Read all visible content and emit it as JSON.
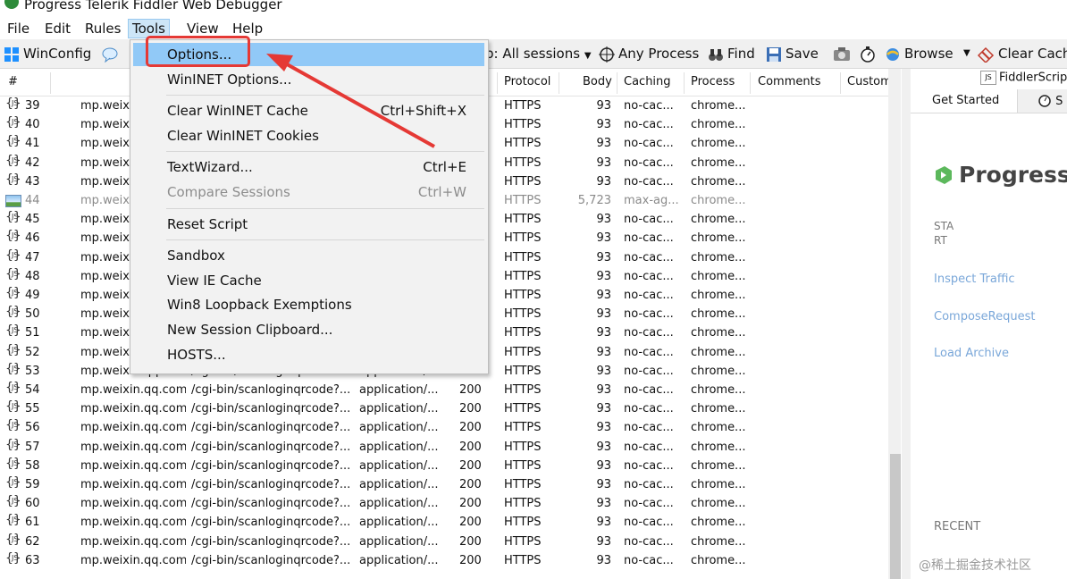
{
  "window": {
    "title": "Progress Telerik Fiddler Web Debugger"
  },
  "menubar": [
    "File",
    "Edit",
    "Rules",
    "Tools",
    "View",
    "Help"
  ],
  "toolbar": {
    "winconfig": "WinConfig",
    "sessions": "p: All sessions",
    "any_process": "Any Process",
    "find": "Find",
    "save": "Save",
    "browse": "Browse",
    "clear_cache": "Clear Cach"
  },
  "grid": {
    "headers": {
      "num": "#",
      "protocol": "Protocol",
      "body": "Body",
      "caching": "Caching",
      "process": "Process",
      "comments": "Comments",
      "custom": "Custom"
    },
    "rows": [
      {
        "id": "39",
        "host": "mp.weixin",
        "url": "",
        "ct": "",
        "result": "",
        "protocol": "HTTPS",
        "body": "93",
        "caching": "no-cac...",
        "process": "chrome..."
      },
      {
        "id": "40",
        "host": "mp.weixin",
        "url": "",
        "ct": "",
        "result": "",
        "protocol": "HTTPS",
        "body": "93",
        "caching": "no-cac...",
        "process": "chrome..."
      },
      {
        "id": "41",
        "host": "mp.weixin",
        "url": "",
        "ct": "",
        "result": "",
        "protocol": "HTTPS",
        "body": "93",
        "caching": "no-cac...",
        "process": "chrome..."
      },
      {
        "id": "42",
        "host": "mp.weixin",
        "url": "",
        "ct": "",
        "result": "",
        "protocol": "HTTPS",
        "body": "93",
        "caching": "no-cac...",
        "process": "chrome..."
      },
      {
        "id": "43",
        "host": "mp.weixin",
        "url": "",
        "ct": "",
        "result": "",
        "protocol": "HTTPS",
        "body": "93",
        "caching": "no-cac...",
        "process": "chrome..."
      },
      {
        "id": "44",
        "host": "mp.weixi",
        "url": "",
        "ct": "",
        "result": "",
        "protocol": "HTTPS",
        "body": "5,723",
        "caching": "max-ag...",
        "process": "chrome...",
        "dim": true
      },
      {
        "id": "45",
        "host": "mp.weixin",
        "url": "",
        "ct": "",
        "result": "",
        "protocol": "HTTPS",
        "body": "93",
        "caching": "no-cac...",
        "process": "chrome..."
      },
      {
        "id": "46",
        "host": "mp.weixin",
        "url": "",
        "ct": "",
        "result": "",
        "protocol": "HTTPS",
        "body": "93",
        "caching": "no-cac...",
        "process": "chrome..."
      },
      {
        "id": "47",
        "host": "mp.weixin",
        "url": "",
        "ct": "",
        "result": "",
        "protocol": "HTTPS",
        "body": "93",
        "caching": "no-cac...",
        "process": "chrome..."
      },
      {
        "id": "48",
        "host": "mp.weixin",
        "url": "",
        "ct": "",
        "result": "",
        "protocol": "HTTPS",
        "body": "93",
        "caching": "no-cac...",
        "process": "chrome..."
      },
      {
        "id": "49",
        "host": "mp.weixin",
        "url": "",
        "ct": "",
        "result": "",
        "protocol": "HTTPS",
        "body": "93",
        "caching": "no-cac...",
        "process": "chrome..."
      },
      {
        "id": "50",
        "host": "mp.weixin",
        "url": "",
        "ct": "",
        "result": "",
        "protocol": "HTTPS",
        "body": "93",
        "caching": "no-cac...",
        "process": "chrome..."
      },
      {
        "id": "51",
        "host": "mp.weixin",
        "url": "",
        "ct": "",
        "result": "",
        "protocol": "HTTPS",
        "body": "93",
        "caching": "no-cac...",
        "process": "chrome..."
      },
      {
        "id": "52",
        "host": "mp.weixin",
        "url": "",
        "ct": "",
        "result": "",
        "protocol": "HTTPS",
        "body": "93",
        "caching": "no-cac...",
        "process": "chrome..."
      },
      {
        "id": "53",
        "host": "mp.weixin.qq.com",
        "url": "/cgi-bin/scanloginqrcode?...",
        "ct": "application/...",
        "result": "200",
        "protocol": "HTTPS",
        "body": "93",
        "caching": "no-cac...",
        "process": "chrome..."
      },
      {
        "id": "54",
        "host": "mp.weixin.qq.com",
        "url": "/cgi-bin/scanloginqrcode?...",
        "ct": "application/...",
        "result": "200",
        "protocol": "HTTPS",
        "body": "93",
        "caching": "no-cac...",
        "process": "chrome..."
      },
      {
        "id": "55",
        "host": "mp.weixin.qq.com",
        "url": "/cgi-bin/scanloginqrcode?...",
        "ct": "application/...",
        "result": "200",
        "protocol": "HTTPS",
        "body": "93",
        "caching": "no-cac...",
        "process": "chrome..."
      },
      {
        "id": "56",
        "host": "mp.weixin.qq.com",
        "url": "/cgi-bin/scanloginqrcode?...",
        "ct": "application/...",
        "result": "200",
        "protocol": "HTTPS",
        "body": "93",
        "caching": "no-cac...",
        "process": "chrome..."
      },
      {
        "id": "57",
        "host": "mp.weixin.qq.com",
        "url": "/cgi-bin/scanloginqrcode?...",
        "ct": "application/...",
        "result": "200",
        "protocol": "HTTPS",
        "body": "93",
        "caching": "no-cac...",
        "process": "chrome..."
      },
      {
        "id": "58",
        "host": "mp.weixin.qq.com",
        "url": "/cgi-bin/scanloginqrcode?...",
        "ct": "application/...",
        "result": "200",
        "protocol": "HTTPS",
        "body": "93",
        "caching": "no-cac...",
        "process": "chrome..."
      },
      {
        "id": "59",
        "host": "mp.weixin.qq.com",
        "url": "/cgi-bin/scanloginqrcode?...",
        "ct": "application/...",
        "result": "200",
        "protocol": "HTTPS",
        "body": "93",
        "caching": "no-cac...",
        "process": "chrome..."
      },
      {
        "id": "60",
        "host": "mp.weixin.qq.com",
        "url": "/cgi-bin/scanloginqrcode?...",
        "ct": "application/...",
        "result": "200",
        "protocol": "HTTPS",
        "body": "93",
        "caching": "no-cac...",
        "process": "chrome..."
      },
      {
        "id": "61",
        "host": "mp.weixin.qq.com",
        "url": "/cgi-bin/scanloginqrcode?...",
        "ct": "application/...",
        "result": "200",
        "protocol": "HTTPS",
        "body": "93",
        "caching": "no-cac...",
        "process": "chrome..."
      },
      {
        "id": "62",
        "host": "mp.weixin.qq.com",
        "url": "/cgi-bin/scanloginqrcode?...",
        "ct": "application/...",
        "result": "200",
        "protocol": "HTTPS",
        "body": "93",
        "caching": "no-cac...",
        "process": "chrome..."
      },
      {
        "id": "63",
        "host": "mp.weixin.qq.com",
        "url": "/cgi-bin/scanloginqrcode?...",
        "ct": "application/...",
        "result": "200",
        "protocol": "HTTPS",
        "body": "93",
        "caching": "no-cac...",
        "process": "chrome..."
      }
    ]
  },
  "tools_menu": {
    "items": [
      {
        "label": "Options...",
        "shortcut": "",
        "highlight": true
      },
      {
        "label": "WinINET Options...",
        "shortcut": ""
      },
      {
        "sep": true
      },
      {
        "label": "Clear WinINET Cache",
        "shortcut": "Ctrl+Shift+X"
      },
      {
        "label": "Clear WinINET Cookies",
        "shortcut": ""
      },
      {
        "sep": true
      },
      {
        "label": "TextWizard...",
        "shortcut": "Ctrl+E"
      },
      {
        "label": "Compare Sessions",
        "shortcut": "Ctrl+W",
        "disabled": true
      },
      {
        "sep": true
      },
      {
        "label": "Reset Script",
        "shortcut": ""
      },
      {
        "sep": true
      },
      {
        "label": "Sandbox",
        "shortcut": ""
      },
      {
        "label": "View IE Cache",
        "shortcut": ""
      },
      {
        "label": "Win8 Loopback Exemptions",
        "shortcut": ""
      },
      {
        "label": "New Session Clipboard...",
        "shortcut": ""
      },
      {
        "label": "HOSTS...",
        "shortcut": ""
      }
    ]
  },
  "right_panel": {
    "fiddlerscript_tab": "FiddlerScript",
    "get_started_tab": "Get Started",
    "second_tab": "S",
    "logo_text": "Progress T",
    "sta": "STA",
    "rt": "RT",
    "links": [
      "Inspect Traffic",
      "ComposeRequest",
      "Load Archive"
    ],
    "recent": "RECENT"
  },
  "watermark": "@稀土掘金技术社区",
  "colors": {
    "accent_red": "#e53935",
    "menu_highlight": "#91c9f7",
    "logo_green": "#5cb85c"
  }
}
